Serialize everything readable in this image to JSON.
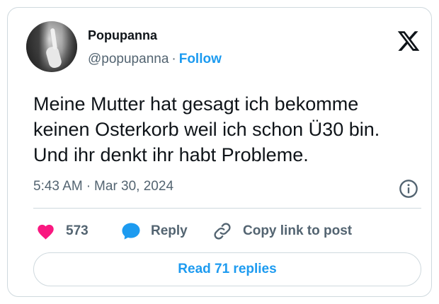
{
  "author": {
    "name": "Popupanna",
    "handle": "@popupanna",
    "separator": "·",
    "follow_label": "Follow"
  },
  "tweet": {
    "text": "Meine Mutter hat gesagt ich bekomme\nkeinen Osterkorb weil ich schon Ü30 bin.\nUnd ihr denkt ihr habt Probleme.",
    "time": "5:43 AM",
    "separator": "·",
    "date": "Mar 30, 2024"
  },
  "actions": {
    "like_count": "573",
    "reply_label": "Reply",
    "copy_label": "Copy link to post"
  },
  "read_replies_label": "Read 71 replies",
  "icons": {
    "brand": "x-logo-icon",
    "info": "info-icon",
    "like": "heart-icon",
    "reply": "speech-bubble-icon",
    "copy": "link-icon"
  },
  "colors": {
    "accent": "#1d9bf0",
    "like": "#f91880",
    "muted": "#536471",
    "border": "#cfd9de"
  }
}
